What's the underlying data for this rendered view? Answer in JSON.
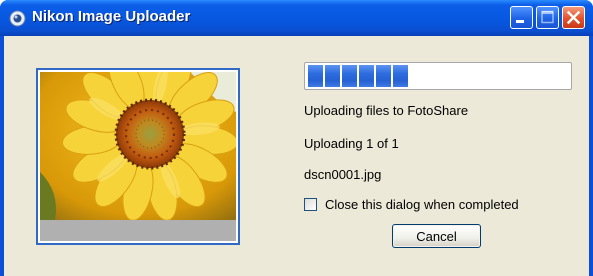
{
  "window": {
    "title": "Nikon Image Uploader",
    "controls": [
      "minimize-icon",
      "maximize-icon",
      "close-icon"
    ]
  },
  "progress": {
    "fraction": 0.4,
    "segments_filled": 6,
    "color": "#2d6ce0"
  },
  "status": {
    "line1": "Uploading files to FotoShare",
    "line2": "Uploading 1 of 1",
    "filename": "dscn0001.jpg"
  },
  "options": {
    "close_when_done_label": "Close this dialog when completed",
    "close_when_done_checked": false
  },
  "buttons": {
    "cancel_label": "Cancel"
  },
  "thumbnail": {
    "subject": "sunflower-photo"
  }
}
